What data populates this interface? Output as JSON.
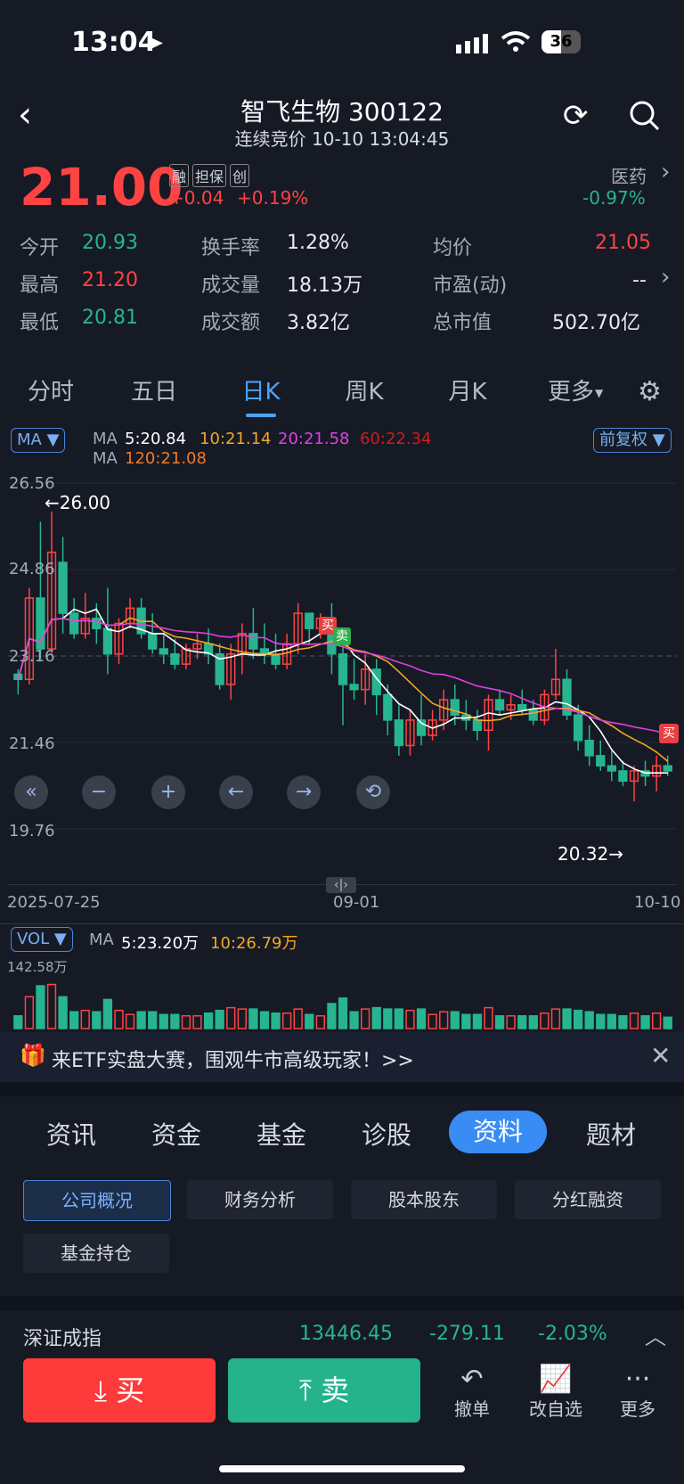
{
  "status": {
    "time": "13:04",
    "battery": "36"
  },
  "header": {
    "title": "智飞生物 300122",
    "subtitle": "连续竞价 10-10 13:04:45"
  },
  "quote": {
    "price": "21.00",
    "tags": [
      "融",
      "担保",
      "创"
    ],
    "change": "+0.04",
    "change_pct": "+0.19%",
    "sector": "医药",
    "sector_change": "-0.97%",
    "stats": [
      {
        "label": "今开",
        "value": "20.93"
      },
      {
        "label": "换手率",
        "value": "1.28%"
      },
      {
        "label": "均价",
        "value": "21.05"
      },
      {
        "label": "最高",
        "value": "21.20"
      },
      {
        "label": "成交量",
        "value": "18.13万"
      },
      {
        "label": "市盈(动)",
        "value": "--"
      },
      {
        "label": "最低",
        "value": "20.81"
      },
      {
        "label": "成交额",
        "value": "3.82亿"
      },
      {
        "label": "总市值",
        "value": "502.70亿"
      }
    ]
  },
  "tabs": [
    "分时",
    "五日",
    "日K",
    "周K",
    "月K",
    "更多"
  ],
  "chart": {
    "indicator": "MA",
    "adjust": "前复权",
    "ma_line1": {
      "label": "MA",
      "ma5": "5:20.84",
      "ma10": "10:21.14",
      "ma20": "20:21.58",
      "ma60": "60:22.34"
    },
    "ma_line2": {
      "label": "MA",
      "ma120": "120:21.08"
    },
    "y_ticks": [
      "26.56",
      "24.86",
      "23.16",
      "21.46",
      "19.76"
    ],
    "high_marker": "←26.00",
    "low_marker": "20.32→",
    "x_ticks": [
      "2025-07-25",
      "09-01",
      "10-10"
    ],
    "buy_sign": "买",
    "sell_sign": "卖",
    "colors": {
      "ma5": "#ffffff",
      "ma10": "#f5a623",
      "ma20": "#e040e0",
      "ma60": "#d01c1c",
      "ma120": "#f07a24",
      "up": "#ff4343",
      "down": "#26b58f"
    }
  },
  "chart_data": {
    "type": "candlestick",
    "x_ticks": [
      "2025-07-25",
      "09-01",
      "10-10"
    ],
    "ylim": [
      19.76,
      26.56
    ],
    "candles": [
      [
        22.8,
        22.9,
        22.4,
        22.7
      ],
      [
        22.7,
        24.5,
        22.6,
        24.3
      ],
      [
        24.3,
        25.8,
        23.1,
        23.3
      ],
      [
        23.3,
        26.0,
        23.2,
        25.2
      ],
      [
        25.0,
        25.5,
        23.6,
        24.0
      ],
      [
        24.0,
        24.3,
        23.5,
        23.6
      ],
      [
        23.6,
        24.4,
        23.5,
        23.9
      ],
      [
        23.9,
        24.2,
        23.4,
        23.7
      ],
      [
        23.7,
        24.5,
        22.8,
        23.2
      ],
      [
        23.2,
        23.9,
        23.0,
        23.8
      ],
      [
        23.8,
        24.3,
        23.7,
        24.1
      ],
      [
        24.1,
        24.3,
        23.5,
        23.6
      ],
      [
        23.6,
        24.0,
        23.2,
        23.3
      ],
      [
        23.3,
        23.6,
        23.0,
        23.2
      ],
      [
        23.2,
        23.5,
        22.9,
        23.0
      ],
      [
        23.0,
        23.4,
        22.9,
        23.3
      ],
      [
        23.3,
        23.6,
        23.1,
        23.4
      ],
      [
        23.4,
        23.7,
        23.0,
        23.2
      ],
      [
        23.2,
        23.4,
        22.5,
        22.6
      ],
      [
        22.6,
        23.4,
        22.3,
        23.2
      ],
      [
        23.2,
        23.8,
        22.8,
        23.6
      ],
      [
        23.6,
        24.1,
        23.1,
        23.3
      ],
      [
        23.3,
        23.8,
        23.0,
        23.2
      ],
      [
        23.2,
        23.6,
        22.9,
        23.0
      ],
      [
        23.0,
        23.6,
        22.9,
        23.4
      ],
      [
        23.4,
        24.2,
        23.2,
        24.0
      ],
      [
        24.0,
        24.0,
        23.4,
        23.7
      ],
      [
        23.7,
        24.0,
        23.5,
        23.9
      ],
      [
        23.9,
        24.2,
        22.8,
        23.2
      ],
      [
        23.2,
        23.6,
        21.8,
        22.6
      ],
      [
        22.6,
        23.1,
        22.3,
        22.5
      ],
      [
        22.5,
        23.2,
        22.2,
        22.9
      ],
      [
        22.9,
        23.1,
        22.0,
        22.4
      ],
      [
        22.4,
        22.6,
        21.6,
        21.9
      ],
      [
        21.9,
        22.2,
        21.2,
        21.4
      ],
      [
        21.4,
        22.1,
        21.2,
        21.9
      ],
      [
        21.9,
        22.4,
        21.4,
        21.6
      ],
      [
        21.6,
        22.1,
        21.5,
        21.9
      ],
      [
        21.9,
        22.5,
        21.7,
        22.3
      ],
      [
        22.3,
        22.6,
        21.8,
        22.0
      ],
      [
        22.0,
        22.3,
        21.7,
        21.9
      ],
      [
        21.9,
        22.1,
        21.5,
        21.7
      ],
      [
        21.7,
        22.4,
        21.3,
        22.3
      ],
      [
        22.3,
        22.5,
        22.0,
        22.1
      ],
      [
        22.1,
        22.4,
        21.9,
        22.2
      ],
      [
        22.2,
        22.5,
        22.0,
        22.1
      ],
      [
        22.1,
        22.3,
        21.8,
        21.9
      ],
      [
        21.9,
        22.5,
        21.8,
        22.4
      ],
      [
        22.4,
        23.3,
        22.3,
        22.7
      ],
      [
        22.7,
        22.9,
        21.9,
        22.0
      ],
      [
        22.0,
        22.2,
        21.3,
        21.5
      ],
      [
        21.5,
        21.8,
        21.0,
        21.2
      ],
      [
        21.2,
        21.5,
        20.9,
        21.0
      ],
      [
        21.0,
        21.3,
        20.7,
        20.9
      ],
      [
        20.9,
        21.1,
        20.6,
        20.7
      ],
      [
        20.7,
        21.0,
        20.3,
        20.9
      ],
      [
        20.9,
        21.1,
        20.6,
        20.8
      ],
      [
        20.8,
        21.2,
        20.5,
        21.0
      ],
      [
        21.0,
        21.2,
        20.8,
        20.9
      ]
    ],
    "volume_ylim": [
      0,
      142.58
    ],
    "volume_max_label": "142.58万",
    "vol_ma": {
      "ma5": "5:23.20万",
      "ma10": "10:26.79万"
    }
  },
  "vol": {
    "indicator": "VOL",
    "label": "MA",
    "ma5": "5:23.20万",
    "ma10": "10:26.79万",
    "max": "142.58万"
  },
  "banner": {
    "text": "来ETF实盘大赛，围观牛市高级玩家！>>"
  },
  "info_tabs": [
    "资讯",
    "资金",
    "基金",
    "诊股",
    "资料",
    "题材"
  ],
  "sub_tabs": [
    "公司概况",
    "财务分析",
    "股本股东",
    "分红融资",
    "基金持仓"
  ],
  "index": {
    "name": "深证成指",
    "value": "13446.45",
    "change": "-279.11",
    "pct": "-2.03%"
  },
  "actions": {
    "buy": "买",
    "sell": "卖",
    "cancel": "撤单",
    "watchlist": "改自选",
    "more": "更多"
  }
}
